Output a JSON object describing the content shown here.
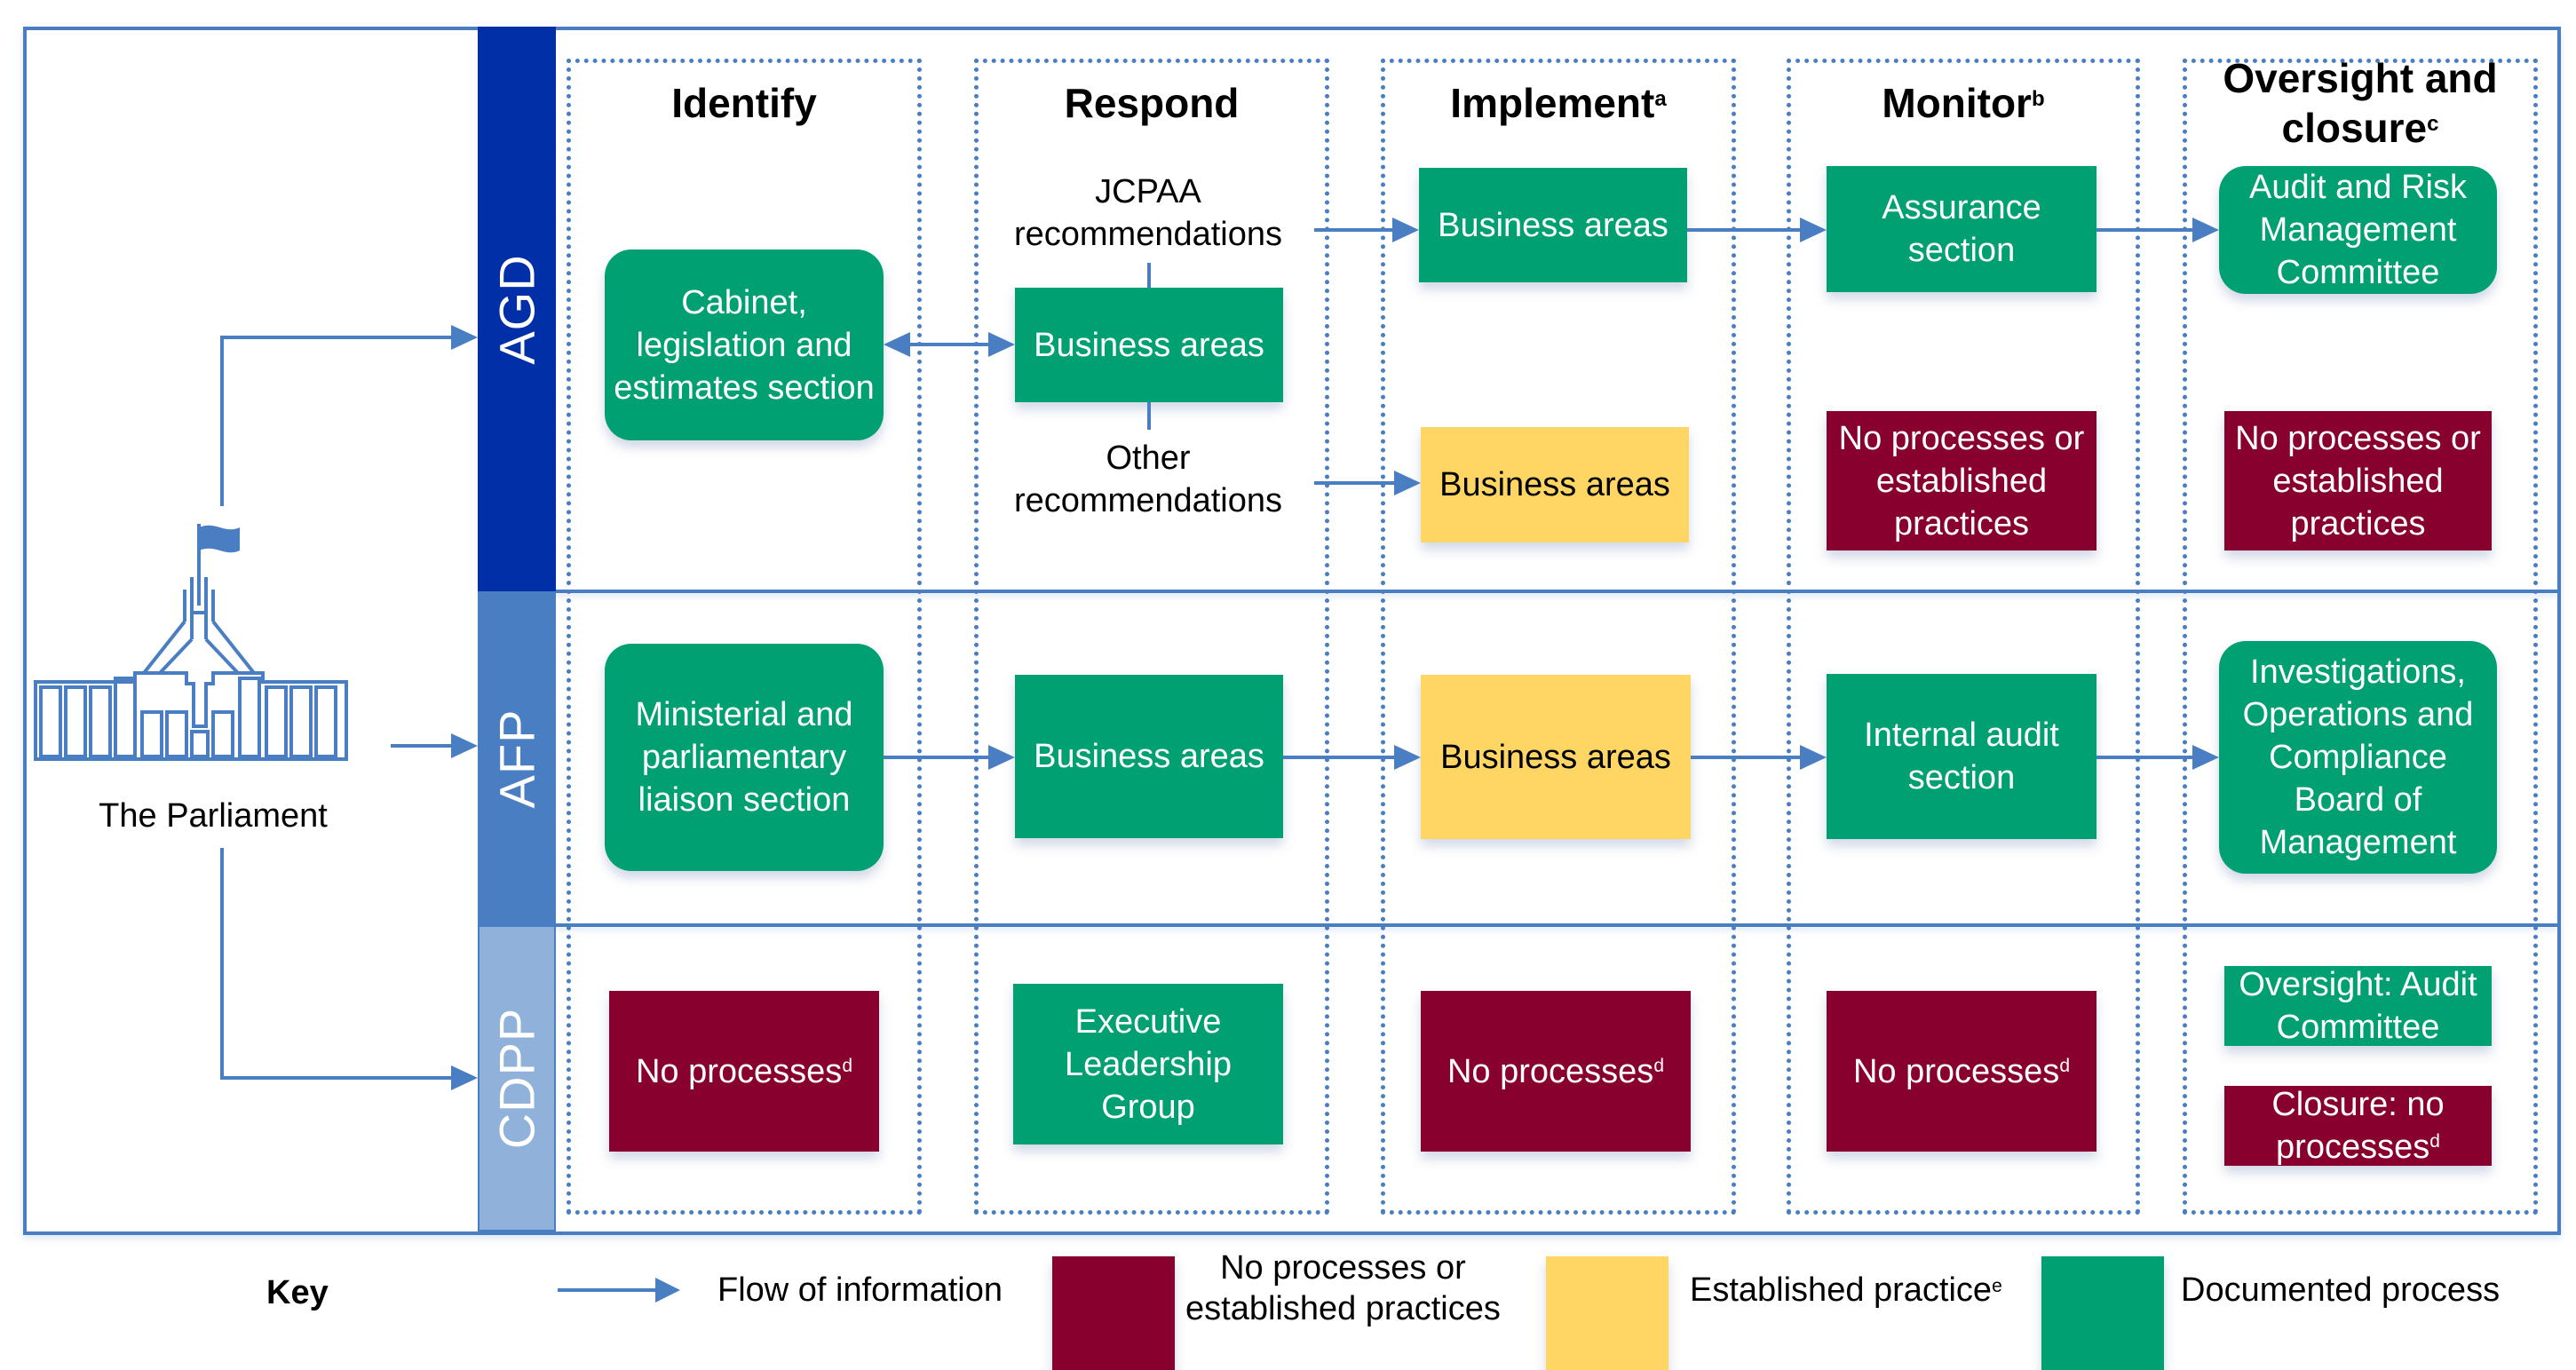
{
  "source": {
    "label": "The Parliament",
    "icon": "parliament-house-icon"
  },
  "colors": {
    "frame": "#4a7ec2",
    "lane_agd": "#002fa7",
    "lane_afp": "#4a7ec2",
    "lane_cdpp": "#8fb1da",
    "documented_process": "#00a072",
    "established_practice": "#ffd563",
    "no_processes": "#88002d"
  },
  "phases": [
    {
      "label": "Identify",
      "note": ""
    },
    {
      "label": "Respond",
      "note": ""
    },
    {
      "label": "Implement",
      "note": "a"
    },
    {
      "label": "Monitor",
      "note": "b"
    },
    {
      "label": "Oversight and",
      "label_line2": "closure",
      "note": "c"
    }
  ],
  "lanes": [
    {
      "label": "AGD",
      "identify": {
        "text": "Cabinet, legislation and estimates section",
        "status": "documented"
      },
      "respond": {
        "text": "Business areas",
        "status": "documented",
        "upper_label_line1": "JCPAA",
        "upper_label_line2": "recommendations",
        "lower_label_line1": "Other",
        "lower_label_line2": "recommendations"
      },
      "implement": [
        {
          "text": "Business areas",
          "status": "documented"
        },
        {
          "text": "Business areas",
          "status": "established"
        }
      ],
      "monitor": [
        {
          "text": "Assurance section",
          "status": "documented"
        },
        {
          "text": "No processes or established practices",
          "status": "none"
        }
      ],
      "oversight": [
        {
          "text": "Audit and Risk Management Committee",
          "status": "documented"
        },
        {
          "text": "No processes or established practices",
          "status": "none"
        }
      ]
    },
    {
      "label": "AFP",
      "identify": {
        "text": "Ministerial and parliamentary liaison section",
        "status": "documented"
      },
      "respond": {
        "text": "Business areas",
        "status": "documented"
      },
      "implement": {
        "text": "Business areas",
        "status": "established"
      },
      "monitor": {
        "text": "Internal audit section",
        "status": "documented"
      },
      "oversight": {
        "text": "Investigations, Operations and Compliance Board of Management",
        "status": "documented"
      }
    },
    {
      "label": "CDPP",
      "identify": {
        "text": "No processes",
        "note": "d",
        "status": "none"
      },
      "respond": {
        "text": "Executive Leadership Group",
        "status": "documented"
      },
      "implement": {
        "text": "No processes",
        "note": "d",
        "status": "none"
      },
      "monitor": {
        "text": "No processes",
        "note": "d",
        "status": "none"
      },
      "oversight": [
        {
          "text": "Oversight: Audit Committee",
          "status": "documented"
        },
        {
          "text": "Closure: no processes",
          "note": "d",
          "status": "none"
        }
      ]
    }
  ],
  "key": {
    "title": "Key",
    "items": [
      {
        "type": "arrow",
        "label": "Flow of information"
      },
      {
        "type": "swatch",
        "status": "none",
        "label_line1": "No processes or",
        "label_line2": "established practices"
      },
      {
        "type": "swatch",
        "status": "established",
        "label": "Established practice",
        "note": "e"
      },
      {
        "type": "swatch",
        "status": "documented",
        "label": "Documented process"
      }
    ]
  }
}
